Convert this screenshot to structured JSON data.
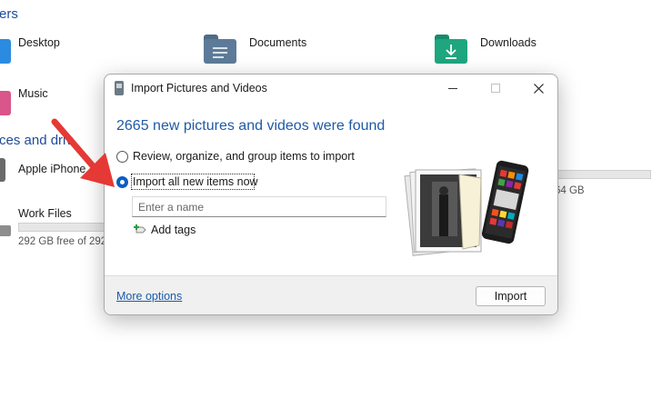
{
  "explorer": {
    "section_folders_partial": "ers",
    "folders": [
      {
        "label": "Desktop",
        "icon": "desktop-folder-icon"
      },
      {
        "label": "Documents",
        "icon": "documents-folder-icon"
      },
      {
        "label": "Downloads",
        "icon": "downloads-folder-icon"
      },
      {
        "label": "Music",
        "icon": "music-folder-icon"
      }
    ],
    "section_devices_partial": "ces and driv",
    "devices": [
      {
        "label": "Apple iPhone",
        "icon": "phone-icon"
      },
      {
        "label": "Work Files",
        "free_text": "292 GB free of 292",
        "icon": "drive-icon"
      }
    ],
    "hidden_drive_free_partial": "64 GB"
  },
  "dialog": {
    "title": "Import Pictures and Videos",
    "heading": "2665 new pictures and videos were found",
    "options": [
      {
        "label": "Review, organize, and group items to import",
        "selected": false
      },
      {
        "label": "Import all new items now",
        "selected": true
      }
    ],
    "name_input": {
      "value": "",
      "placeholder": "Enter a name"
    },
    "add_tags_label": "Add tags",
    "more_options_label": "More options",
    "import_button_label": "Import"
  },
  "colors": {
    "accent": "#0a5fc0",
    "heading_blue": "#1f5aa6",
    "annotation_arrow": "#e53935"
  }
}
